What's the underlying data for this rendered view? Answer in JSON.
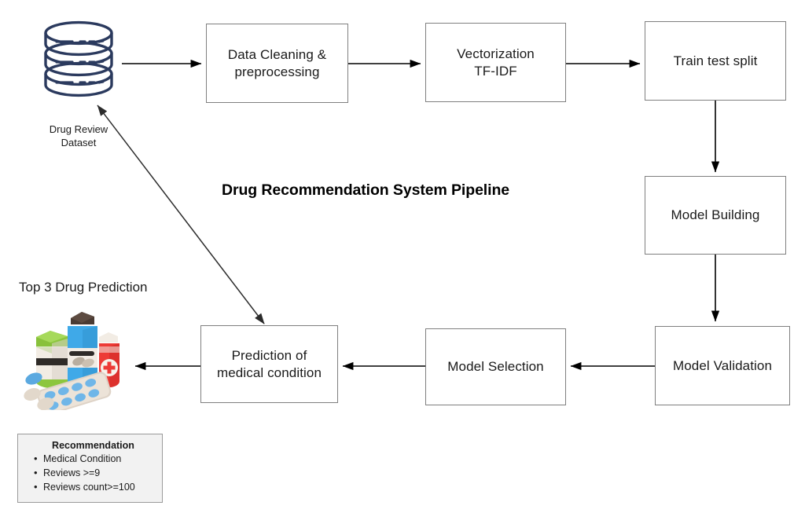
{
  "diagram": {
    "title": "Drug Recommendation System Pipeline",
    "background": "#ffffff",
    "box_border_color": "#7f7f7f",
    "arrow_color": "#000000",
    "database_icon_color": "#2b3a5e"
  },
  "nodes": {
    "data_cleaning": "Data Cleaning & preprocessing",
    "data_cleaning_line1": "Data Cleaning &",
    "data_cleaning_line2": "preprocessing",
    "vectorization_line1": "Vectorization",
    "vectorization_line2": "TF-IDF",
    "train_test_split": "Train test split",
    "model_building": "Model Building",
    "model_validation": "Model Validation",
    "model_selection": "Model Selection",
    "prediction_line1": "Prediction of",
    "prediction_line2": "medical condition"
  },
  "labels": {
    "dataset_caption_line1": "Drug Review",
    "dataset_caption_line2": "Dataset",
    "top_prediction_heading": "Top 3 Drug Prediction"
  },
  "recommendation_card": {
    "title": "Recommendation",
    "items": [
      "Medical Condition",
      "Reviews >=9",
      "Reviews count>=100"
    ]
  },
  "icons": {
    "database": "database-cylinder-icon",
    "medicines": "medicine-bottles-pills-icon"
  },
  "flow_edges": [
    {
      "from": "drug-review-dataset",
      "to": "data-cleaning",
      "style": "straight-right"
    },
    {
      "from": "data-cleaning",
      "to": "vectorization",
      "style": "straight-right"
    },
    {
      "from": "vectorization",
      "to": "train-test-split",
      "style": "straight-right"
    },
    {
      "from": "train-test-split",
      "to": "model-building",
      "style": "straight-down"
    },
    {
      "from": "model-building",
      "to": "model-validation",
      "style": "straight-down"
    },
    {
      "from": "model-validation",
      "to": "model-selection",
      "style": "straight-left"
    },
    {
      "from": "model-selection",
      "to": "prediction-of-medical-condition",
      "style": "straight-left"
    },
    {
      "from": "prediction-of-medical-condition",
      "to": "top-3-drug-prediction",
      "style": "straight-left"
    },
    {
      "from": "prediction-of-medical-condition",
      "to": "drug-review-dataset",
      "style": "diagonal-double-headed"
    }
  ]
}
